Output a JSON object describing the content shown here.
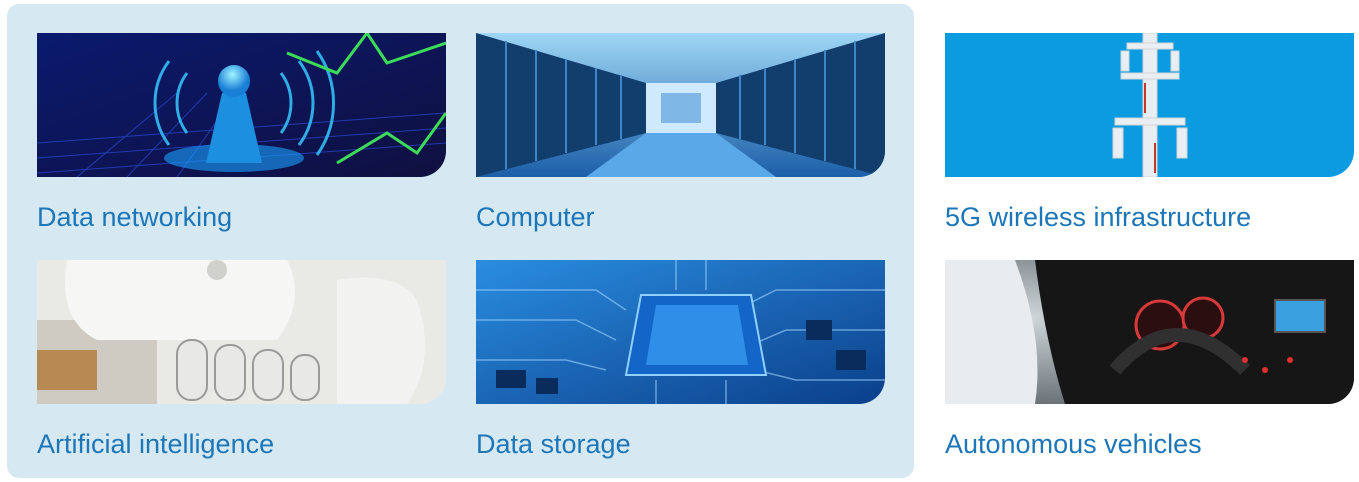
{
  "tiles": [
    {
      "label": "Data networking",
      "image": "antenna-signal-image"
    },
    {
      "label": "Computer",
      "image": "server-room-image"
    },
    {
      "label": "5G wireless infrastructure",
      "image": "cell-tower-image"
    },
    {
      "label": "Artificial intelligence",
      "image": "robot-hand-image"
    },
    {
      "label": "Data storage",
      "image": "circuit-chip-image"
    },
    {
      "label": "Autonomous vehicles",
      "image": "car-dashboard-image"
    }
  ],
  "colors": {
    "panel": "#d6e9f2",
    "label": "#1c76b8",
    "sky": "#0a9be0"
  }
}
